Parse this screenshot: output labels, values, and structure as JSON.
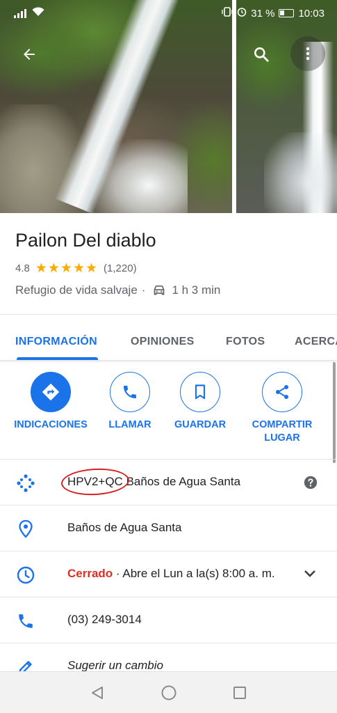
{
  "status_bar": {
    "battery": "31 %",
    "time": "10:03"
  },
  "top_bar": {
    "back_icon": "arrow-back-icon",
    "search_icon": "search-icon",
    "more_icon": "more-vert-icon"
  },
  "place": {
    "name": "Pailon Del diablo",
    "rating": "4.8",
    "rating_stars": 5,
    "reviews": "(1,220)",
    "category": "Refugio de vida salvaje",
    "separator": "·",
    "drive_time": "1 h 3 min"
  },
  "tabs": [
    {
      "label": "INFORMACIÓN",
      "active": true
    },
    {
      "label": "OPINIONES",
      "active": false
    },
    {
      "label": "FOTOS",
      "active": false
    },
    {
      "label": "ACERCA",
      "active": false
    }
  ],
  "actions": [
    {
      "label": "INDICACIONES",
      "icon": "directions-icon"
    },
    {
      "label": "LLAMAR",
      "icon": "phone-icon"
    },
    {
      "label": "GUARDAR",
      "icon": "bookmark-icon"
    },
    {
      "label": "COMPARTIR LUGAR",
      "icon": "share-icon"
    }
  ],
  "info": {
    "plus_code": "HPV2+QC",
    "plus_code_locality": "Baños de Agua Santa",
    "address": "Baños de Agua Santa",
    "hours_status": "Cerrado",
    "hours_detail": "· Abre el Lun a la(s) 8:00 a. m.",
    "phone": "(03) 249-3014",
    "suggest_edit": "Sugerir un cambio"
  },
  "colors": {
    "accent": "#1a73e8",
    "star": "#f9ab00",
    "closed": "#d93025",
    "annotation": "#d62020"
  }
}
